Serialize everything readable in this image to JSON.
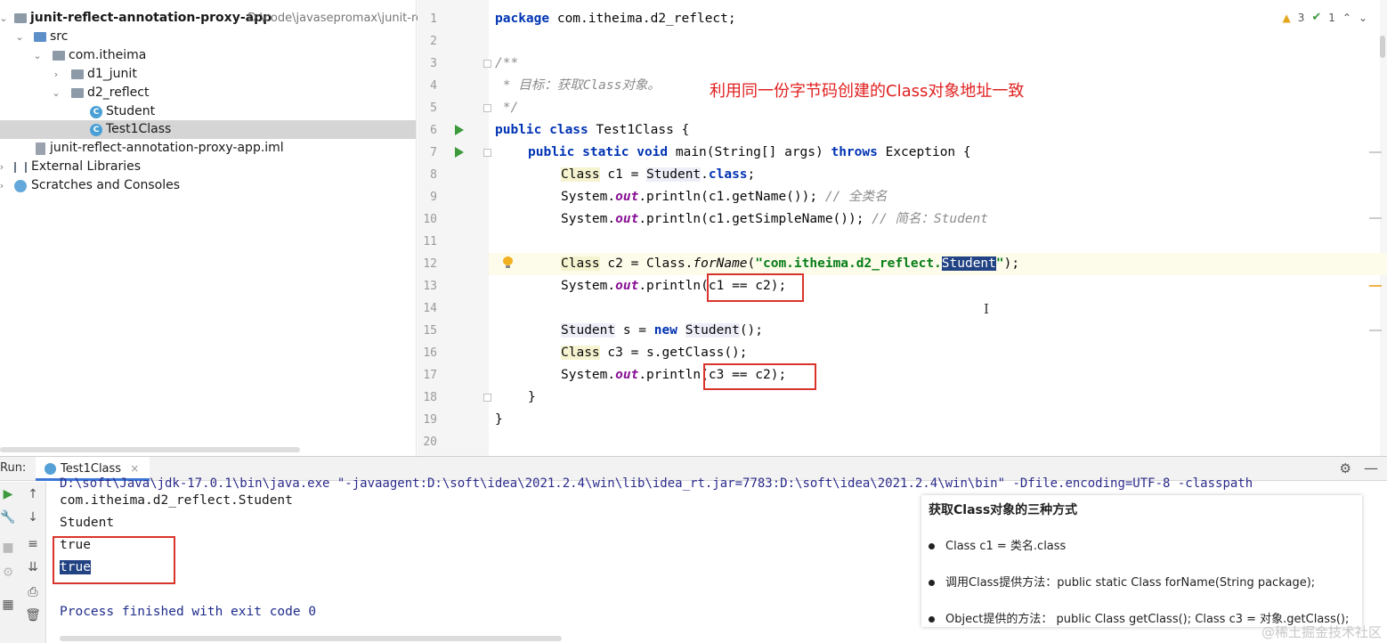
{
  "project": {
    "root_name": "junit-reflect-annotation-proxy-app",
    "root_path": "D:\\code\\javasepromax\\junit-re",
    "src": "src",
    "package": "com.itheima",
    "pkg1": "d1_junit",
    "pkg2": "d2_reflect",
    "class1": "Student",
    "class2": "Test1Class",
    "iml": "junit-reflect-annotation-proxy-app.iml",
    "libs": "External Libraries",
    "scratches": "Scratches and Consoles"
  },
  "editor": {
    "line_numbers": [
      "1",
      "2",
      "3",
      "4",
      "5",
      "6",
      "7",
      "8",
      "9",
      "10",
      "11",
      "12",
      "13",
      "14",
      "15",
      "16",
      "17",
      "18",
      "19",
      "20"
    ],
    "warnings": "3",
    "checks": "1",
    "annotation": "利用同一份字节码创建的Class对象地址一致",
    "code": {
      "l1_kw": "package",
      "l1_rest": " com.itheima.d2_reflect;",
      "l3": "/**",
      "l4": " * 目标：获取Class对象。",
      "l5": " */",
      "l6_kw": "public class",
      "l6_rest": " Test1Class {",
      "l7_kw1": "public static void",
      "l7_mid": " main(String[] args) ",
      "l7_kw2": "throws",
      "l7_rest": " Exception {",
      "l8_cls": "Class",
      "l8_mid": " c1 = ",
      "l8_student": "Student",
      "l8_dot": ".",
      "l8_kw": "class",
      "l8_end": ";",
      "l9_a": "System.",
      "l9_out": "out",
      "l9_b": ".println(c1.getName()); ",
      "l9_comment": "// 全类名",
      "l10_a": "System.",
      "l10_out": "out",
      "l10_b": ".println(c1.getSimpleName()); ",
      "l10_comment": "// 简名：Student",
      "l12_cls": "Class",
      "l12_mid": " c2 = Class.",
      "l12_method": "forName",
      "l12_open": "(",
      "l12_str": "\"com.itheima.d2_reflect.",
      "l12_sel": "Student",
      "l12_strend": "\"",
      "l12_end": ");",
      "l13_a": "System.",
      "l13_out": "out",
      "l13_b": ".println",
      "l13_c": "(c1 == c2);",
      "l15_student": "Student",
      "l15_mid": " s = ",
      "l15_kw": "new",
      "l15_sp": " ",
      "l15_student2": "Student",
      "l15_end": "();",
      "l16_cls": "Class",
      "l16_rest": " c3 = s.getClass();",
      "l17_a": "System.",
      "l17_out": "out",
      "l17_b": ".println",
      "l17_c": "(c3 == c2);",
      "l18": "}",
      "l19": "}"
    }
  },
  "run": {
    "label": "Run:",
    "tab": "Test1Class",
    "tab_close": "×",
    "cut_line": "D:\\soft\\Java\\jdk-17.0.1\\bin\\java.exe \"-javaagent:D:\\soft\\idea\\2021.2.4\\win\\lib\\idea_rt.jar=7783:D:\\soft\\idea\\2021.2.4\\win\\bin\" -Dfile.encoding=UTF-8 -classpath",
    "output": [
      "com.itheima.d2_reflect.Student",
      "Student",
      "true",
      "true"
    ],
    "finished": "Process finished with exit code 0"
  },
  "card": {
    "title": "获取Class对象的三种方式",
    "items": [
      "Class c1 = 类名.class",
      "调用Class提供方法：public static Class forName(String package);",
      "Object提供的方法： public Class getClass();   Class c3 = 对象.getClass();"
    ]
  },
  "watermark": "@稀土掘金技术社区",
  "colors": {
    "keyword": "#0033b3",
    "string": "#067d17",
    "static_field": "#871094",
    "comment": "#8c8c8c",
    "annotation_red": "#e02020",
    "selection": "#214283"
  }
}
